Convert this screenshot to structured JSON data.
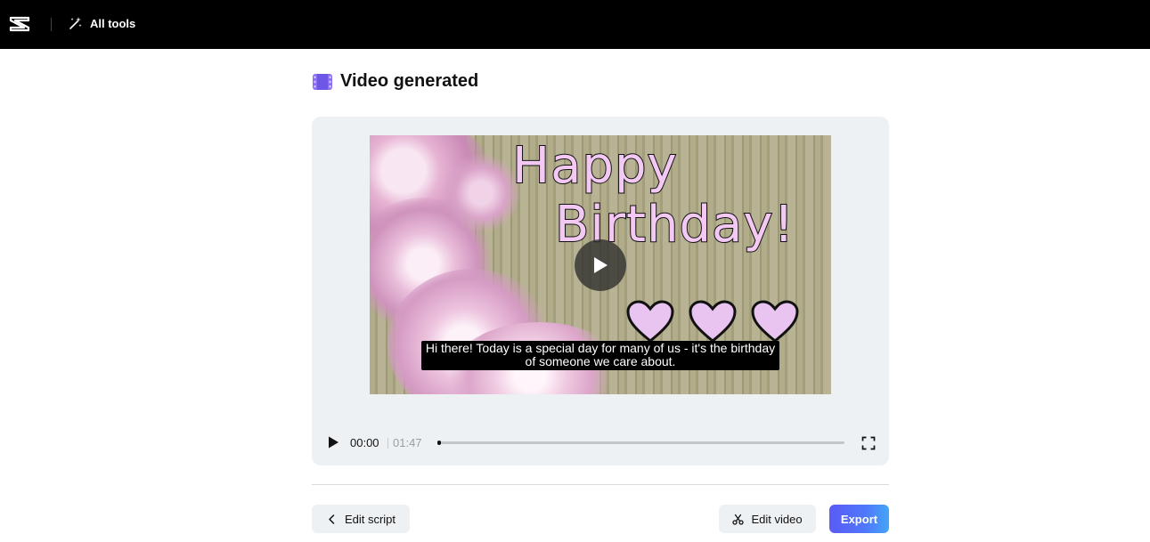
{
  "topbar": {
    "all_tools_label": "All tools",
    "logo_icon": "capcut-logo-icon",
    "all_tools_icon": "magic-wand-icon"
  },
  "page": {
    "title": "Video generated",
    "title_icon": "film-strip-icon"
  },
  "video": {
    "overlay_line1": "Happy",
    "overlay_line2": "Birthday!",
    "subtitle": "Hi there! Today is a special day for many of us - it's the birthday of someone we care about.",
    "heart_color": "#e9c4f0",
    "play_icon": "play-icon"
  },
  "controls": {
    "current_time": "00:00",
    "total_time": "01:47",
    "progress": 0,
    "play_icon": "play-icon",
    "fullscreen_icon": "fullscreen-icon"
  },
  "actions": {
    "edit_script_label": "Edit script",
    "edit_video_label": "Edit video",
    "export_label": "Export",
    "edit_script_icon": "chevron-left-icon",
    "edit_video_icon": "scissors-icon"
  },
  "colors": {
    "topbar_bg": "#000000",
    "accent": "#5a6cf8",
    "panel_bg": "#eef1f4",
    "film_icon": "#7b5cf5"
  }
}
